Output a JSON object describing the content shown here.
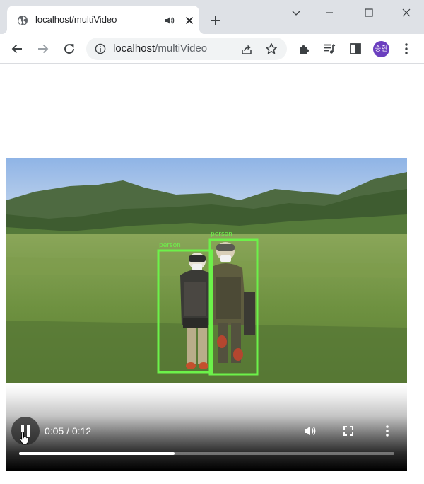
{
  "browser": {
    "tab": {
      "title": "localhost/multiVideo",
      "favicon": "globe-icon",
      "audio_icon": "speaker-icon",
      "close_icon": "close-icon"
    },
    "new_tab_icon": "plus-icon",
    "window_controls": [
      "chevron-down-icon",
      "minimize-icon",
      "maximize-icon",
      "close-icon"
    ],
    "nav": [
      "back-arrow-icon",
      "forward-arrow-icon",
      "reload-icon"
    ],
    "omnibox": {
      "info_icon": "info-icon",
      "host": "localhost",
      "path": "/multiVideo",
      "share_icon": "share-icon",
      "bookmark_icon": "star-icon"
    },
    "toolbar_icons": [
      "extensions-puzzle-icon",
      "media-queue-icon",
      "side-panel-icon"
    ],
    "profile": {
      "initials": "승현",
      "color": "#6b3fbf"
    },
    "menu_icon": "kebab-menu-icon"
  },
  "video": {
    "detections": [
      {
        "label": "person",
        "color": "#6cf24a"
      },
      {
        "label": "person",
        "color": "#6cf24a"
      }
    ],
    "controls": {
      "state": "playing",
      "play_pause_icon": "pause-icon",
      "time": "0:05 / 0:12",
      "progress": 0.414,
      "volume_icon": "volume-icon",
      "fullscreen_icon": "fullscreen-icon",
      "more_icon": "more-vert-icon"
    }
  }
}
